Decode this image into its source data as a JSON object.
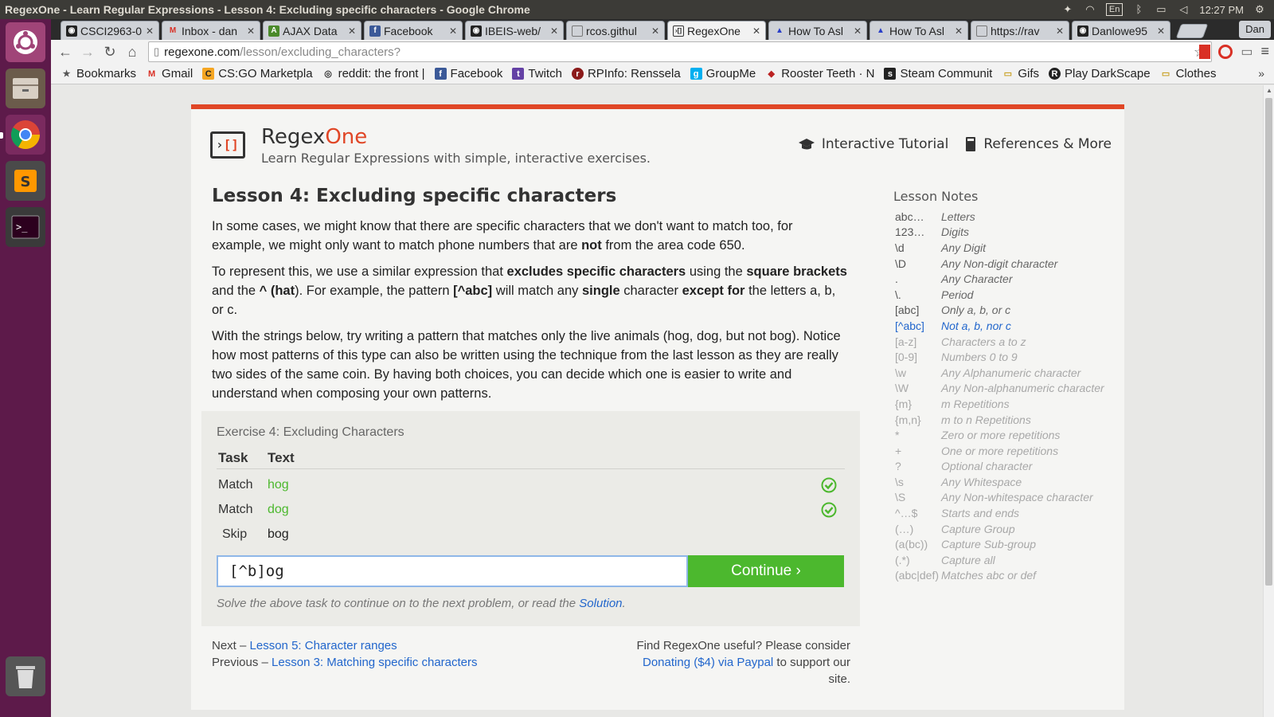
{
  "topbar": {
    "window_title": "RegexOne - Learn Regular Expressions - Lesson 4: Excluding specific characters - Google Chrome",
    "keyboard_layout": "En",
    "time": "12:27 PM"
  },
  "tabs": [
    {
      "label": "CSCI2963-0",
      "icon": "github-icon",
      "active": false
    },
    {
      "label": "Inbox - dan",
      "icon": "gmail-icon",
      "active": false
    },
    {
      "label": "AJAX Data",
      "icon": "ajax-icon",
      "active": false
    },
    {
      "label": "Facebook",
      "icon": "facebook-icon",
      "active": false
    },
    {
      "label": "IBEIS-web/",
      "icon": "github-icon",
      "active": false
    },
    {
      "label": "rcos.githul",
      "icon": "page-icon",
      "active": false
    },
    {
      "label": "RegexOne",
      "icon": "regexone-icon",
      "active": true
    },
    {
      "label": "How To Asl",
      "icon": "triangle-icon",
      "active": false
    },
    {
      "label": "How To Asl",
      "icon": "triangle-icon",
      "active": false
    },
    {
      "label": "https://rav",
      "icon": "page-icon",
      "active": false
    },
    {
      "label": "Danlowe95",
      "icon": "github-icon",
      "active": false
    }
  ],
  "user_chip": "Dan",
  "omnibox": {
    "host": "regexone.com",
    "path": "/lesson/excluding_characters?"
  },
  "bookmarks": [
    {
      "label": "Bookmarks",
      "icon": "star-icon"
    },
    {
      "label": "Gmail",
      "icon": "gmail-icon"
    },
    {
      "label": "CS:GO Marketpla",
      "icon": "csgo-icon"
    },
    {
      "label": "reddit: the front |",
      "icon": "reddit-icon"
    },
    {
      "label": "Facebook",
      "icon": "facebook-icon"
    },
    {
      "label": "Twitch",
      "icon": "twitch-icon"
    },
    {
      "label": "RPInfo: Renssela",
      "icon": "rpi-icon"
    },
    {
      "label": "GroupMe",
      "icon": "groupme-icon"
    },
    {
      "label": "Rooster Teeth · N",
      "icon": "roosterteeth-icon"
    },
    {
      "label": "Steam Communit",
      "icon": "steam-icon"
    },
    {
      "label": "Gifs",
      "icon": "folder-icon"
    },
    {
      "label": "Play DarkScape",
      "icon": "runescape-icon"
    },
    {
      "label": "Clothes",
      "icon": "folder-icon"
    }
  ],
  "site": {
    "name_main": "Regex",
    "name_accent": "One",
    "tagline": "Learn Regular Expressions with simple, interactive exercises.",
    "nav": [
      "Interactive Tutorial",
      "References & More"
    ]
  },
  "lesson": {
    "title": "Lesson 4: Excluding specific characters",
    "p1_a": "In some cases, we might know that there are specific characters that we don't want to match too, for example, we might only want to match phone numbers that are ",
    "p1_b": "not",
    "p1_c": " from the area code 650.",
    "p2_a": "To represent this, we use a similar expression that ",
    "p2_b": "excludes specific characters",
    "p2_c": " using the ",
    "p2_d": "square brackets",
    "p2_e": " and the ",
    "p2_f": "^ (hat",
    "p2_g": "). For example, the pattern ",
    "p2_h": "[^abc]",
    "p2_i": " will match any ",
    "p2_j": "single",
    "p2_k": " character ",
    "p2_l": "except for",
    "p2_m": " the letters a, b, or c.",
    "p3": "With the strings below, try writing a pattern that matches only the live animals (hog, dog, but not bog). Notice how most patterns of this type can also be written using the technique from the last lesson as they are really two sides of the same coin. By having both choices, you can decide which one is easier to write and understand when composing your own patterns."
  },
  "exercise": {
    "title": "Exercise 4: Excluding Characters",
    "col_task": "Task",
    "col_text": "Text",
    "rows": [
      {
        "task": "Match",
        "text": "hog"
      },
      {
        "task": "Match",
        "text": "dog"
      },
      {
        "task": "Skip",
        "text": "bog"
      }
    ],
    "input_value": "[^b]og",
    "continue_label": "Continue ›",
    "hint_prefix": "Solve the above task to continue on to the next problem, or read the ",
    "hint_link": "Solution",
    "hint_suffix": "."
  },
  "footer": {
    "next_prefix": "Next – ",
    "next_link": "Lesson 5: Character ranges",
    "prev_prefix": "Previous – ",
    "prev_link": "Lesson 3: Matching specific characters",
    "donate_line1": "Find RegexOne useful? Please consider",
    "donate_link": "Donating ($4) via Paypal",
    "donate_suffix": " to support our site."
  },
  "notes": {
    "title": "Lesson Notes",
    "items": [
      {
        "k": "abc…",
        "v": "Letters",
        "state": "past"
      },
      {
        "k": "123…",
        "v": "Digits",
        "state": "past"
      },
      {
        "k": "\\d",
        "v": "Any Digit",
        "state": "past"
      },
      {
        "k": "\\D",
        "v": "Any Non-digit character",
        "state": "past"
      },
      {
        "k": ".",
        "v": "Any Character",
        "state": "past"
      },
      {
        "k": "\\.",
        "v": "Period",
        "state": "past"
      },
      {
        "k": "[abc]",
        "v": "Only a, b, or c",
        "state": "past"
      },
      {
        "k": "[^abc]",
        "v": "Not a, b, nor c",
        "state": "current"
      },
      {
        "k": "[a-z]",
        "v": "Characters a to z",
        "state": "future"
      },
      {
        "k": "[0-9]",
        "v": "Numbers 0 to 9",
        "state": "future"
      },
      {
        "k": "\\w",
        "v": "Any Alphanumeric character",
        "state": "future"
      },
      {
        "k": "\\W",
        "v": "Any Non-alphanumeric character",
        "state": "future"
      },
      {
        "k": "{m}",
        "v": "m Repetitions",
        "state": "future"
      },
      {
        "k": "{m,n}",
        "v": "m to n Repetitions",
        "state": "future"
      },
      {
        "k": "*",
        "v": "Zero or more repetitions",
        "state": "future"
      },
      {
        "k": "+",
        "v": "One or more repetitions",
        "state": "future"
      },
      {
        "k": "?",
        "v": "Optional character",
        "state": "future"
      },
      {
        "k": "\\s",
        "v": "Any Whitespace",
        "state": "future"
      },
      {
        "k": "\\S",
        "v": "Any Non-whitespace character",
        "state": "future"
      },
      {
        "k": "^…$",
        "v": "Starts and ends",
        "state": "future"
      },
      {
        "k": "(…)",
        "v": "Capture Group",
        "state": "future"
      },
      {
        "k": "(a(bc))",
        "v": "Capture Sub-group",
        "state": "future"
      },
      {
        "k": "(.*)",
        "v": "Capture all",
        "state": "future"
      },
      {
        "k": "(abc|def)",
        "v": "Matches abc or def",
        "state": "future"
      }
    ]
  },
  "colors": {
    "accent": "#e04626",
    "success": "#4cb82e",
    "link": "#2266cc",
    "launcher": "#5d1a4a"
  }
}
